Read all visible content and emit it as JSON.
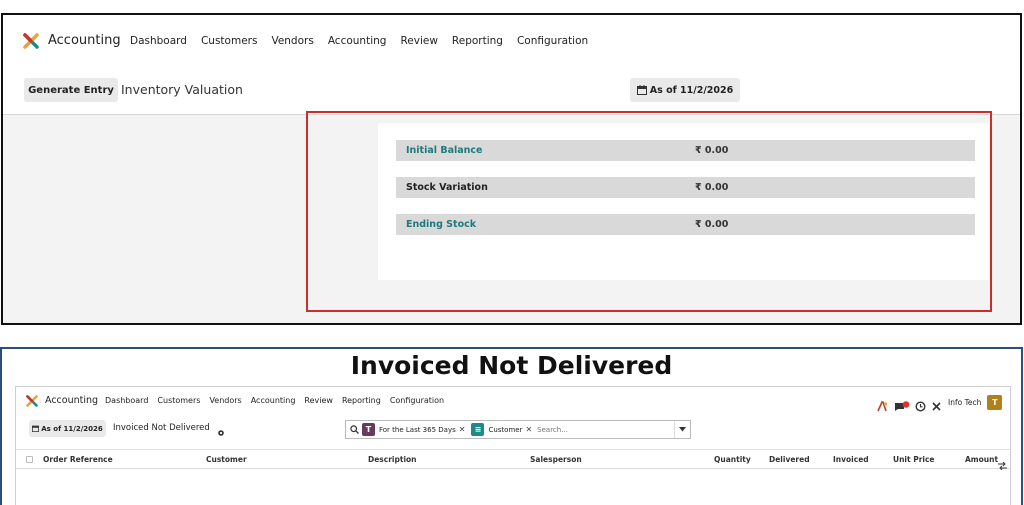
{
  "top": {
    "nav": {
      "app_name": "Accounting",
      "menu": [
        "Dashboard",
        "Customers",
        "Vendors",
        "Accounting",
        "Review",
        "Reporting",
        "Configuration"
      ]
    },
    "control": {
      "generate_button": "Generate Entry",
      "page_title": "Inventory Valuation",
      "date_filter": "As of 11/2/2026"
    },
    "report": {
      "rows": [
        {
          "label": "Initial Balance",
          "amount": "₹ 0.00"
        },
        {
          "label": "Stock Variation",
          "amount": "₹ 0.00"
        },
        {
          "label": "Ending Stock",
          "amount": "₹ 0.00"
        }
      ]
    }
  },
  "bottom": {
    "section_title": "Invoiced Not Delivered",
    "nav": {
      "app_name": "Accounting",
      "menu": [
        "Dashboard",
        "Customers",
        "Vendors",
        "Accounting",
        "Review",
        "Reporting",
        "Configuration"
      ],
      "company": "Info Tech",
      "avatar_initial": "T"
    },
    "control": {
      "date_filter": "As of 11/2/2026",
      "page_title": "Invoiced Not Delivered"
    },
    "search": {
      "facets": [
        {
          "icon_letter": "T",
          "label": "For the Last 365 Days"
        },
        {
          "icon_letter": "≡",
          "label": "Customer"
        }
      ],
      "placeholder": "Search..."
    },
    "table": {
      "columns": [
        "Order Reference",
        "Customer",
        "Description",
        "Salesperson",
        "Quantity",
        "Delivered",
        "Invoiced",
        "Unit Price",
        "Amount"
      ]
    }
  },
  "colors": {
    "accent_teal": "#1f7a7a",
    "highlight_red": "#c9302c",
    "facet_purple": "#6b3a5a",
    "facet_teal": "#1f8a8a",
    "avatar": "#b0801a"
  }
}
